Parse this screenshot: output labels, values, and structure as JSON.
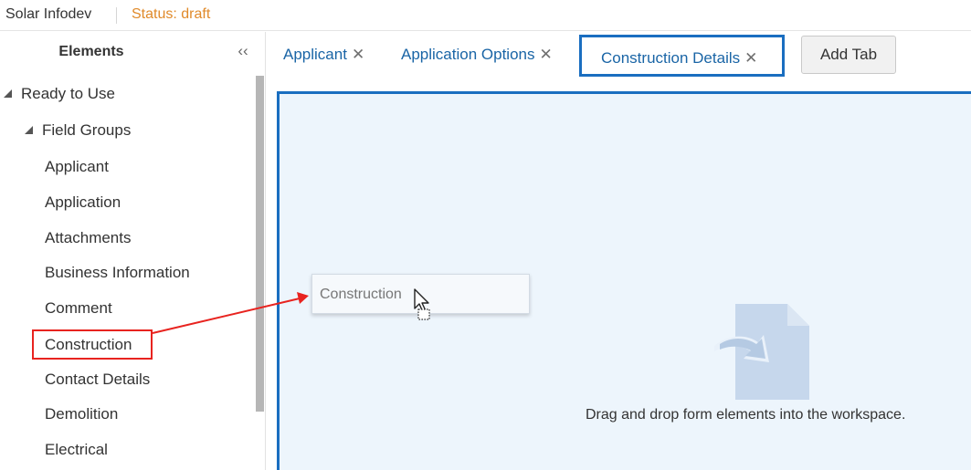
{
  "header": {
    "app_title": "Solar Infodev",
    "status": "Status: draft"
  },
  "elements_panel": {
    "title": "Elements",
    "collapse_glyph": "‹‹",
    "sections": {
      "ready_to_use": "Ready to Use",
      "field_groups": "Field Groups"
    },
    "items": [
      "Applicant",
      "Application",
      "Attachments",
      "Business Information",
      "Comment",
      "Construction",
      "Contact Details",
      "Demolition",
      "Electrical"
    ],
    "highlighted_item": "Construction"
  },
  "tabs": {
    "items": [
      {
        "label": "Applicant",
        "active": false
      },
      {
        "label": "Application Options",
        "active": false
      },
      {
        "label": "Construction Details",
        "active": true
      }
    ],
    "close_glyph": "✕",
    "add_label": "Add Tab"
  },
  "workspace": {
    "drag_element_label": "Construction",
    "drop_hint": "Drag and drop form elements into the workspace.",
    "drop_icon": "document-drop-icon"
  },
  "colors": {
    "accent": "#1a6ec0",
    "tab_text": "#1a65a6",
    "status": "#e08a2a",
    "annotation": "#e8231f",
    "workspace_bg": "#edf5fc",
    "drop_icon": "#c6d7ec"
  }
}
